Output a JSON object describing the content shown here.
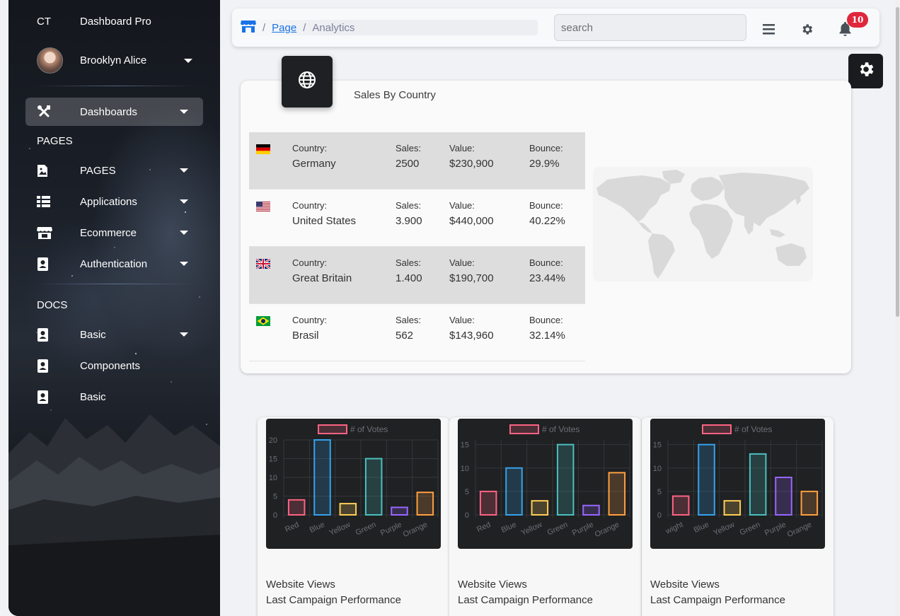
{
  "sidebar": {
    "brand_mini": "CT",
    "brand_name": "Dashboard Pro",
    "user_name": "Brooklyn Alice",
    "items": [
      {
        "label": "Dashboards",
        "icon": "tools-icon",
        "active": true,
        "caret": true
      },
      {
        "label": "PAGES",
        "icon": "image-file-icon",
        "caret": true
      },
      {
        "label": "Applications",
        "icon": "table-list-icon",
        "caret": true
      },
      {
        "label": "Ecommerce",
        "icon": "store-icon",
        "caret": true
      },
      {
        "label": "Authentication",
        "icon": "contact-book-icon",
        "caret": true
      }
    ],
    "section_pages": "PAGES",
    "section_docs": "DOCS",
    "docs_items": [
      {
        "label": "Basic",
        "icon": "contact-book-icon",
        "caret": true
      },
      {
        "label": "Components",
        "icon": "contact-book-icon",
        "caret": false
      },
      {
        "label": "Basic",
        "icon": "contact-book-icon",
        "caret": false
      }
    ]
  },
  "topbar": {
    "breadcrumb": {
      "link": "Page",
      "current": "Analytics"
    },
    "search_placeholder": "search",
    "notification_count": "10"
  },
  "sales": {
    "title": "Sales By Country",
    "keys": {
      "country": "Country:",
      "sales": "Sales:",
      "value": "Value:",
      "bounce": "Bounce:"
    },
    "rows": [
      {
        "flag": "germany",
        "country": "Germany",
        "sales": "2500",
        "value": "$230,900",
        "bounce": "29.9%"
      },
      {
        "flag": "usa",
        "country": "United States",
        "sales": "3.900",
        "value": "$440,000",
        "bounce": "40.22%"
      },
      {
        "flag": "uk",
        "country": "Great Britain",
        "sales": "1.400",
        "value": "$190,700",
        "bounce": "23.44%"
      },
      {
        "flag": "brazil",
        "country": "Brasil",
        "sales": "562",
        "value": "$143,960",
        "bounce": "32.14%"
      }
    ]
  },
  "chart_cards": [
    {
      "title": "Website Views",
      "subtitle": "Last Campaign Performance"
    },
    {
      "title": "Website Views",
      "subtitle": "Last Campaign Performance"
    },
    {
      "title": "Website Views",
      "subtitle": "Last Campaign Performance"
    }
  ],
  "chart_data": [
    {
      "type": "bar",
      "legend": "# of Votes",
      "categories": [
        "Red",
        "Blue",
        "Yellow",
        "Green",
        "Purple",
        "Orange"
      ],
      "values": [
        4,
        20,
        3,
        15,
        2,
        6
      ],
      "ylim": [
        0,
        20
      ],
      "yticks": [
        0,
        5,
        10,
        15,
        20
      ],
      "colors": [
        "#ff6384",
        "#36a2eb",
        "#ffce56",
        "#4bc0c0",
        "#9966ff",
        "#ff9f40"
      ]
    },
    {
      "type": "bar",
      "legend": "# of Votes",
      "categories": [
        "Red",
        "Blue",
        "Yellow",
        "Green",
        "Purple",
        "Orange"
      ],
      "values": [
        5,
        10,
        3,
        15,
        2,
        9
      ],
      "ylim": [
        0,
        16
      ],
      "yticks": [
        0,
        5,
        10,
        15
      ],
      "colors": [
        "#ff6384",
        "#36a2eb",
        "#ffce56",
        "#4bc0c0",
        "#9966ff",
        "#ff9f40"
      ]
    },
    {
      "type": "bar",
      "legend": "# of Votes",
      "categories": [
        "wight",
        "Blue",
        "Yellow",
        "Green",
        "Purple",
        "Orange"
      ],
      "values": [
        4,
        15,
        3,
        13,
        8,
        5
      ],
      "ylim": [
        0,
        16
      ],
      "yticks": [
        0,
        5,
        10,
        15
      ],
      "colors": [
        "#ff6384",
        "#36a2eb",
        "#ffce56",
        "#4bc0c0",
        "#9966ff",
        "#ff9f40"
      ]
    }
  ]
}
